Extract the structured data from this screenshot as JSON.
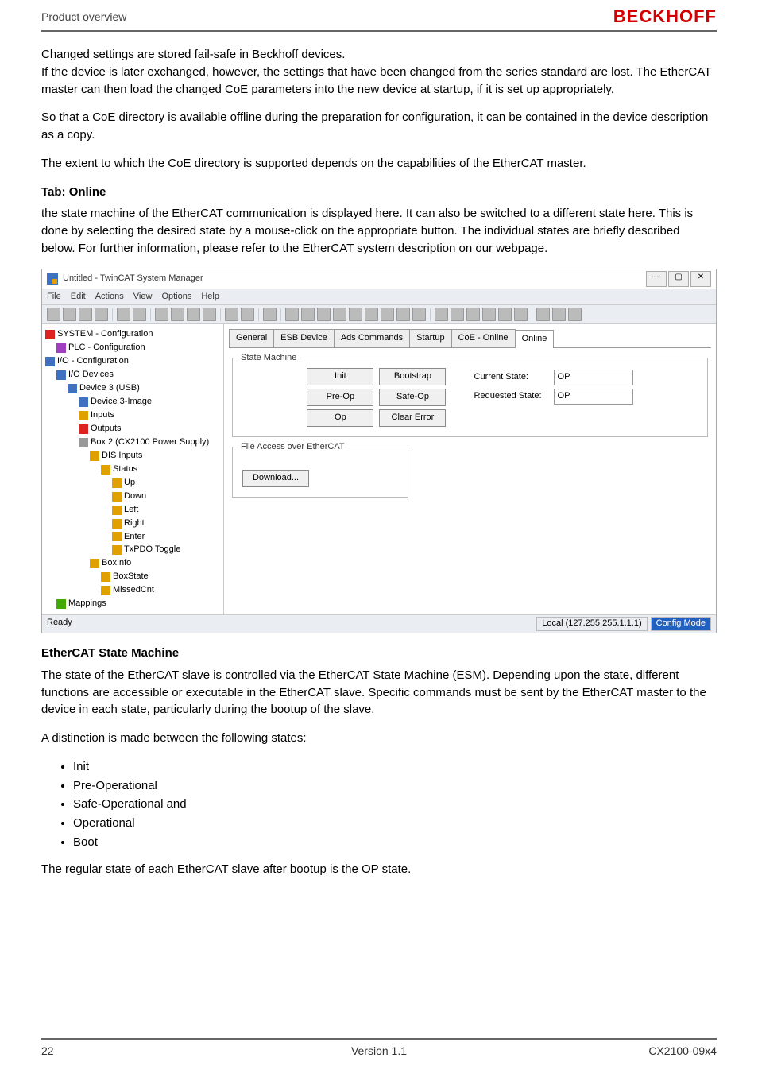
{
  "header": {
    "section": "Product overview",
    "logo": "BECKHOFF"
  },
  "paragraphs": {
    "p1": "Changed settings are stored fail-safe in Beckhoff devices.",
    "p2": "If the device is later exchanged, however, the settings that have been changed from the series standard are lost. The EtherCAT master can then load the changed CoE parameters into the new device at startup, if it is set up appropriately.",
    "p3": "So that a CoE directory is available offline during the preparation for configuration, it can be contained in the device description as a copy.",
    "p4": "The extent to which the CoE directory is supported depends on the capabilities of the EtherCAT master.",
    "tab_online_head": "Tab: Online",
    "p5": "the state machine of the EtherCAT communication is displayed here. It can also be switched to a different state here. This is done by selecting the desired state by a mouse-click on the appropriate button. The individual states are briefly described below. For further information, please refer to the EtherCAT system description on our webpage.",
    "ecsm_head": "EtherCAT State Machine",
    "p6": "The state of the EtherCAT slave is controlled via the EtherCAT State Machine (ESM). Depending upon the state, different functions are accessible or executable in the EtherCAT slave. Specific commands must be sent by the EtherCAT master to the device in each state, particularly during the bootup of the slave.",
    "p7": "A distinction is made between the following states:",
    "p8": "The regular state of each EtherCAT slave after bootup is the OP state."
  },
  "states_list": [
    "Init",
    "Pre-Operational",
    "Safe-Operational and",
    "Operational",
    "Boot"
  ],
  "screenshot": {
    "window_title": "Untitled - TwinCAT System Manager",
    "menu": [
      "File",
      "Edit",
      "Actions",
      "View",
      "Options",
      "Help"
    ],
    "tree": {
      "system": "SYSTEM - Configuration",
      "plc": "PLC - Configuration",
      "io": "I/O - Configuration",
      "devices": "I/O Devices",
      "device3": "Device 3 (USB)",
      "image": "Device 3-Image",
      "inputs": "Inputs",
      "outputs": "Outputs",
      "box2": "Box 2 (CX2100 Power Supply)",
      "dis": "DIS Inputs",
      "status": "Status",
      "up": "Up",
      "down": "Down",
      "left": "Left",
      "right": "Right",
      "enter": "Enter",
      "txpdo": "TxPDO Toggle",
      "boxinfo": "BoxInfo",
      "boxstate": "BoxState",
      "missed": "MissedCnt",
      "mappings": "Mappings"
    },
    "tabs": [
      "General",
      "ESB Device",
      "Ads Commands",
      "Startup",
      "CoE - Online",
      "Online"
    ],
    "active_tab": "Online",
    "state_machine": {
      "legend": "State Machine",
      "buttons": {
        "init": "Init",
        "bootstrap": "Bootstrap",
        "preop": "Pre-Op",
        "safeop": "Safe-Op",
        "op": "Op",
        "clear": "Clear Error"
      },
      "current_label": "Current State:",
      "current_value": "OP",
      "requested_label": "Requested State:",
      "requested_value": "OP"
    },
    "file_access": {
      "legend": "File Access over EtherCAT",
      "download": "Download..."
    },
    "status": {
      "ready": "Ready",
      "local": "Local (127.255.255.1.1.1)",
      "mode": "Config Mode"
    }
  },
  "footer": {
    "page": "22",
    "version": "Version 1.1",
    "model": "CX2100-09x4"
  }
}
